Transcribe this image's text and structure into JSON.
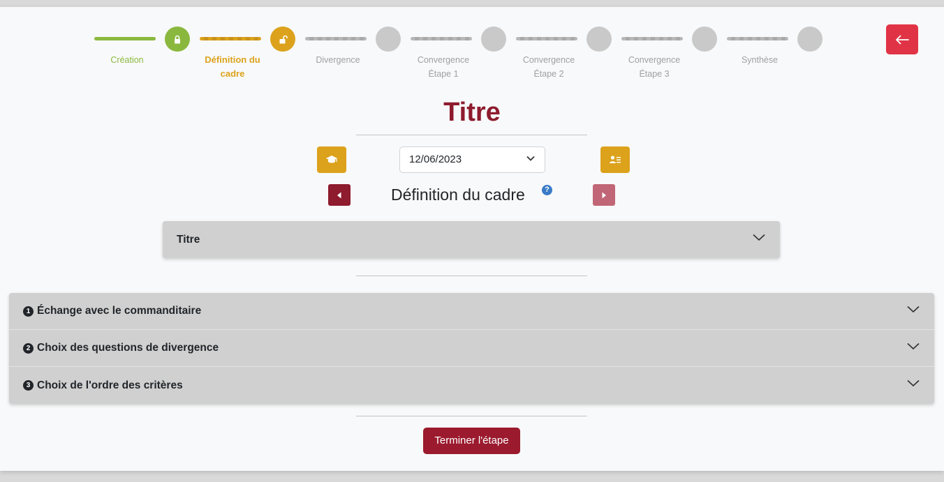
{
  "stepper": {
    "steps": [
      {
        "label": "Création",
        "state": "done"
      },
      {
        "label": "Définition du cadre",
        "state": "active"
      },
      {
        "label": "Divergence",
        "state": "pending"
      },
      {
        "label": "Convergence Étape 1",
        "state": "pending"
      },
      {
        "label": "Convergence Étape 2",
        "state": "pending"
      },
      {
        "label": "Convergence Étape 3",
        "state": "pending"
      },
      {
        "label": "Synthèse",
        "state": "pending"
      }
    ],
    "step_labels": {
      "s1": "Création",
      "s2a": "Définition du",
      "s2b": "cadre",
      "s3": "Divergence",
      "s4a": "Convergence",
      "s4b": "Étape 1",
      "s5a": "Convergence",
      "s5b": "Étape 2",
      "s6a": "Convergence",
      "s6b": "Étape 3",
      "s7": "Synthèse"
    }
  },
  "colors": {
    "done": "#8ab83e",
    "active": "#dca21c",
    "pending": "#c9c9c9",
    "title": "#8e1b2e",
    "back_button": "#e03446",
    "primary": "#9b1a2e"
  },
  "header": {
    "title": "Titre",
    "date_value": "12/06/2023",
    "stage_title": "Définition du cadre",
    "help_symbol": "?"
  },
  "title_accordion": {
    "label": "Titre"
  },
  "sections": [
    {
      "number": "1",
      "label": "Échange avec le commanditaire"
    },
    {
      "number": "2",
      "label": "Choix des questions de divergence"
    },
    {
      "number": "3",
      "label": "Choix de l'ordre des critères"
    }
  ],
  "footer": {
    "finish_label": "Terminer l'étape"
  },
  "icons": {
    "back": "arrow-left-icon",
    "tutorial": "graduation-cap-icon",
    "participants": "user-list-icon",
    "prev": "caret-left-icon",
    "next": "caret-right-icon"
  }
}
